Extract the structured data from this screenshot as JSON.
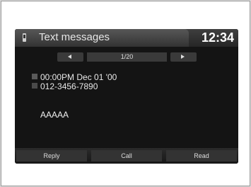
{
  "header": {
    "title": "Text messages",
    "clock": "12:34"
  },
  "pager": {
    "page": "1/20"
  },
  "message": {
    "datetime": "00:00PM Dec 01 '00",
    "number": "012-3456-7890",
    "text": "AAAAA"
  },
  "buttons": {
    "reply": "Reply",
    "call": "Call",
    "read": "Read"
  },
  "colors": {
    "screen": "#141414",
    "text": "#e8e8e8",
    "button": "#333333"
  }
}
